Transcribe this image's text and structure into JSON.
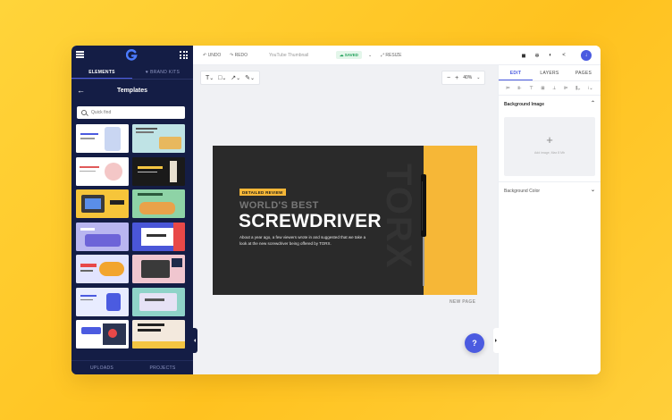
{
  "sidebar": {
    "tabs": [
      {
        "label": "ELEMENTS",
        "active": true
      },
      {
        "label": "BRAND KITS",
        "active": false
      }
    ],
    "title": "Templates",
    "search_placeholder": "Quick find",
    "bottom_tabs": [
      "UPLOADS",
      "PROJECTS"
    ]
  },
  "topbar": {
    "undo": "UNDO",
    "redo": "REDO",
    "doc_name": "YouTube Thumbnail",
    "saved": "SAVED",
    "resize": "RESIZE"
  },
  "toolbar": {
    "zoom": "40%"
  },
  "design": {
    "tag": "DETAILED REVIEW",
    "subtitle": "WORLD'S BEST",
    "title": "SCREWDRIVER",
    "body": "About a year ago, a few viewers wrote in and suggested that we take a look at the new screwdriver being offered by TORX.",
    "brand": "TORX",
    "accent_color": "#f6b737"
  },
  "canvas": {
    "new_page": "NEW PAGE",
    "help": "?"
  },
  "right_panel": {
    "tabs": [
      {
        "label": "EDIT",
        "active": true
      },
      {
        "label": "LAYERS",
        "active": false
      },
      {
        "label": "PAGES",
        "active": false
      }
    ],
    "background_image": "Background Image",
    "dropzone_hint": "Add image, Max 8 Mb",
    "background_color": "Background Color"
  },
  "colors": {
    "accent": "#4b5be0",
    "sidebar_bg": "#141d45",
    "page_bg": "#ffcc2e"
  }
}
